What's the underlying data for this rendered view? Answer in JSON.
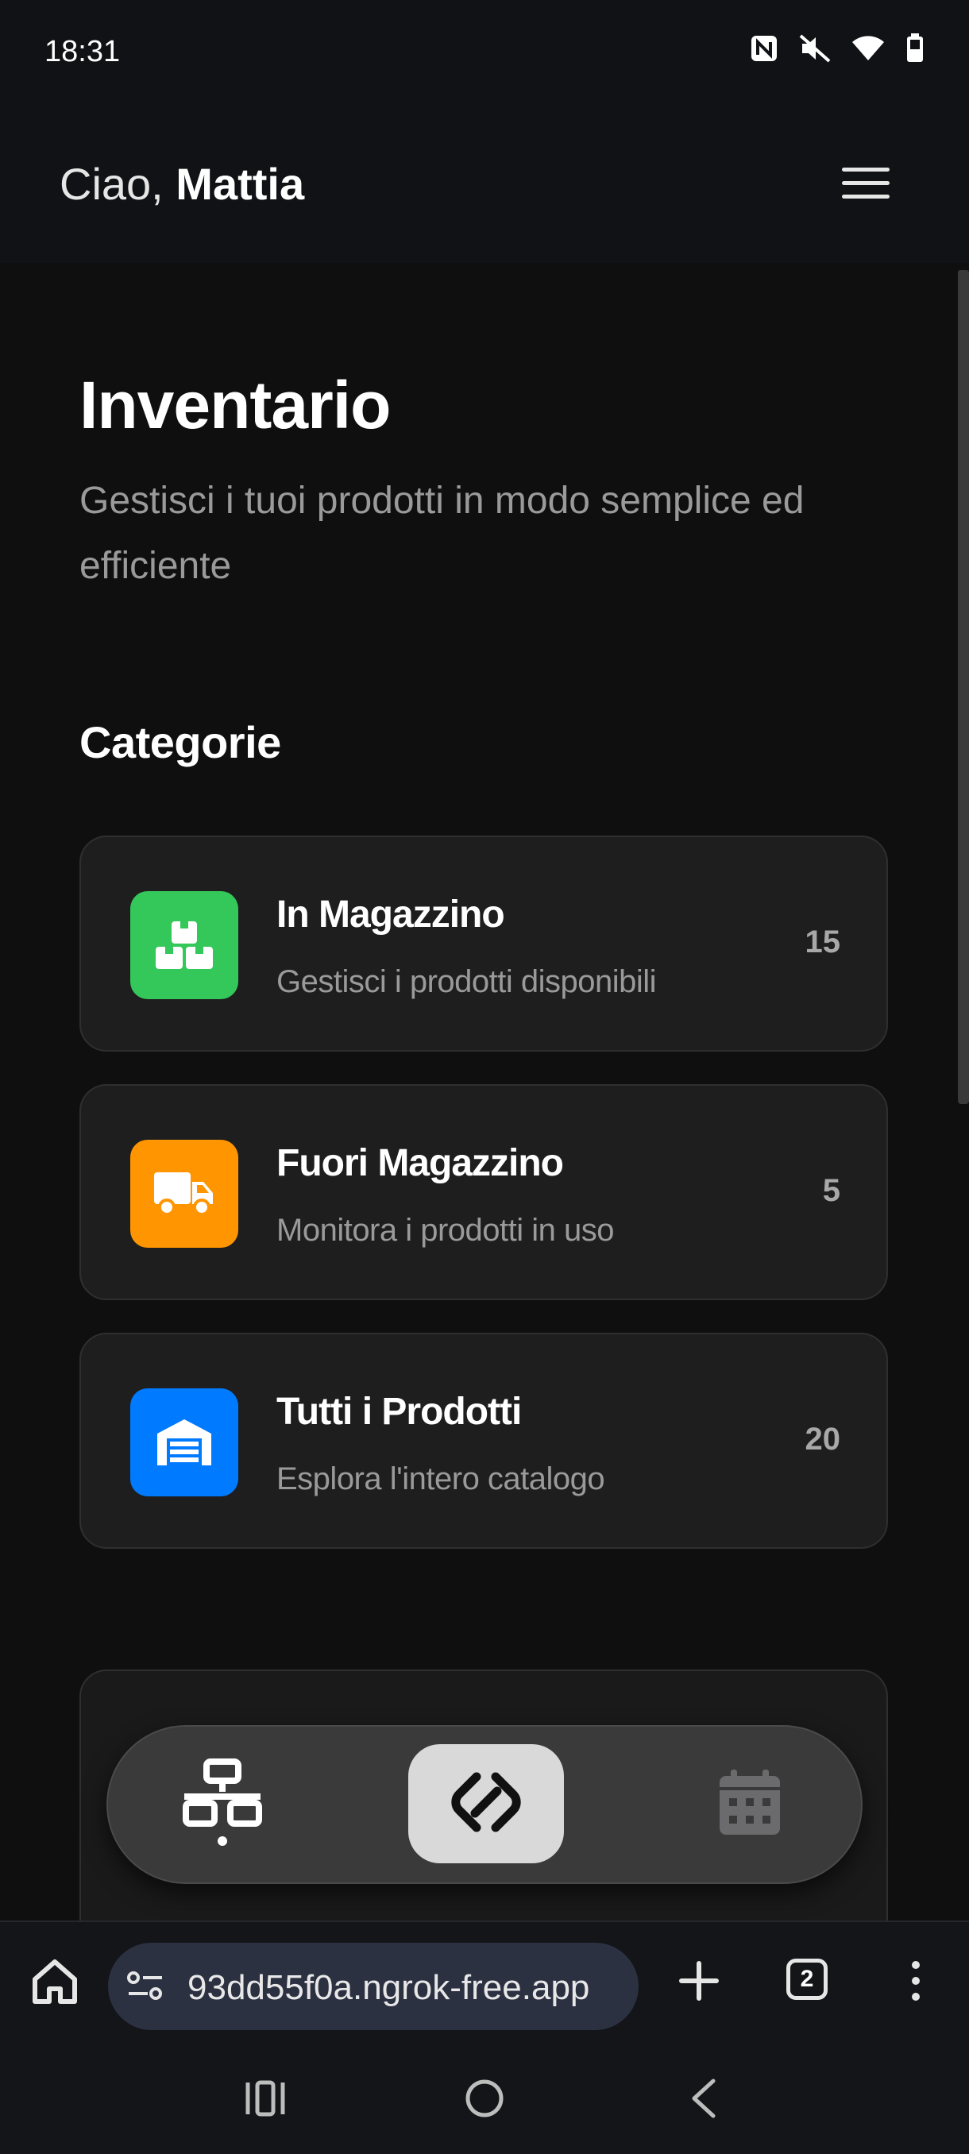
{
  "status_bar": {
    "time": "18:31",
    "icons": [
      "nfc-icon",
      "mute-icon",
      "wifi-icon",
      "battery-icon"
    ]
  },
  "header": {
    "greeting_prefix": "Ciao, ",
    "user_name": "Mattia",
    "menu_icon": "hamburger-menu-icon"
  },
  "main": {
    "title": "Inventario",
    "subtitle": "Gestisci i tuoi prodotti in modo semplice ed efficiente",
    "categories_title": "Categorie",
    "categories": [
      {
        "title": "In Magazzino",
        "description": "Gestisci i prodotti disponibili",
        "count": "15",
        "icon": "boxes-icon",
        "color": "#34c759"
      },
      {
        "title": "Fuori Magazzino",
        "description": "Monitora i prodotti in uso",
        "count": "5",
        "icon": "truck-icon",
        "color": "#ff9500"
      },
      {
        "title": "Tutti i Prodotti",
        "description": "Esplora l'intero catalogo",
        "count": "20",
        "icon": "warehouse-icon",
        "color": "#007aff"
      }
    ]
  },
  "floating_nav": {
    "items": [
      {
        "icon": "network-icon",
        "active": false
      },
      {
        "icon": "nfc-scan-icon",
        "active": true
      },
      {
        "icon": "calendar-icon",
        "active": false
      }
    ]
  },
  "browser": {
    "url": "93dd55f0a.ngrok-free.app",
    "tab_count": "2"
  },
  "colors": {
    "background": "#0f0f10",
    "card": "#1e1e1f",
    "muted_text": "#9a9a9a",
    "url_pill": "#2c3142"
  }
}
